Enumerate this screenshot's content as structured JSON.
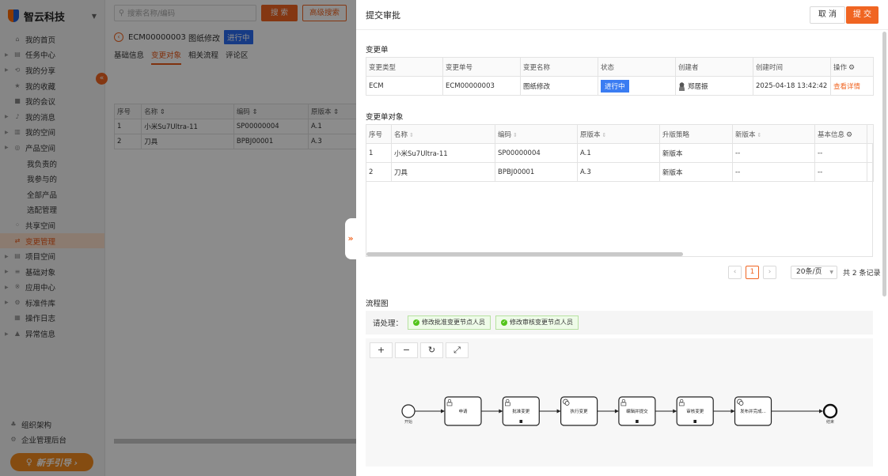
{
  "app": {
    "brand": "智云科技",
    "nav": [
      {
        "label": "我的首页",
        "icon": "home-icon",
        "glyph": "⌂",
        "expand": false,
        "sub": false
      },
      {
        "label": "任务中心",
        "icon": "task-icon",
        "glyph": "▤",
        "expand": true,
        "sub": false
      },
      {
        "label": "我的分享",
        "icon": "share-icon",
        "glyph": "⟲",
        "expand": true,
        "sub": false
      },
      {
        "label": "我的收藏",
        "icon": "star-icon",
        "glyph": "★",
        "expand": false,
        "sub": false
      },
      {
        "label": "我的会议",
        "icon": "meeting-icon",
        "glyph": "■",
        "expand": false,
        "sub": false
      },
      {
        "label": "我的消息",
        "icon": "bell-icon",
        "glyph": "♪",
        "expand": true,
        "sub": false
      },
      {
        "label": "我的空间",
        "icon": "space-icon",
        "glyph": "▥",
        "expand": true,
        "sub": false
      },
      {
        "label": "产品空间",
        "icon": "product-icon",
        "glyph": "◎",
        "expand": true,
        "sub": false
      },
      {
        "label": "我负责的",
        "icon": "",
        "glyph": "",
        "expand": false,
        "sub": true
      },
      {
        "label": "我参与的",
        "icon": "",
        "glyph": "",
        "expand": false,
        "sub": true
      },
      {
        "label": "全部产品",
        "icon": "",
        "glyph": "",
        "expand": false,
        "sub": true
      },
      {
        "label": "选配管理",
        "icon": "",
        "glyph": "",
        "expand": false,
        "sub": true
      },
      {
        "label": "共享空间",
        "icon": "shared-icon",
        "glyph": "⁘",
        "expand": false,
        "sub": false
      },
      {
        "label": "变更管理",
        "icon": "change-icon",
        "glyph": "⇄",
        "expand": false,
        "sub": false,
        "active": true
      },
      {
        "label": "项目空间",
        "icon": "project-icon",
        "glyph": "▤",
        "expand": true,
        "sub": false
      },
      {
        "label": "基础对象",
        "icon": "object-icon",
        "glyph": "≡",
        "expand": true,
        "sub": false
      },
      {
        "label": "应用中心",
        "icon": "app-icon",
        "glyph": "※",
        "expand": true,
        "sub": false
      },
      {
        "label": "标准件库",
        "icon": "library-icon",
        "glyph": "⚙",
        "expand": true,
        "sub": false
      },
      {
        "label": "操作日志",
        "icon": "log-icon",
        "glyph": "▦",
        "expand": false,
        "sub": false
      },
      {
        "label": "异常信息",
        "icon": "warning-icon",
        "glyph": "▲",
        "expand": true,
        "sub": false
      }
    ],
    "bottom_nav": [
      {
        "label": "组织架构",
        "icon": "org-icon",
        "glyph": "♣"
      },
      {
        "label": "企业管理后台",
        "icon": "admin-icon",
        "glyph": "⚙"
      }
    ],
    "guide": "新手引导 ›",
    "search_placeholder": "搜索名称/编码",
    "search_btn": "搜 索",
    "adv_search_btn": "高级搜索",
    "crumb_code": "ECM00000003",
    "crumb_name": "图纸修改",
    "crumb_status": "进行中",
    "tabs": [
      {
        "label": "基础信息",
        "active": false
      },
      {
        "label": "变更对象",
        "active": true
      },
      {
        "label": "相关流程",
        "active": false
      },
      {
        "label": "评论区",
        "active": false
      }
    ],
    "bg_table": {
      "headers": [
        "序号",
        "名称 ⇕",
        "编码 ⇕",
        "原版本 ⇕"
      ],
      "rows": [
        [
          "1",
          "小米Su7Ultra-11",
          "SP00000004",
          "A.1"
        ],
        [
          "2",
          "刀具",
          "BPBJ00001",
          "A.3"
        ]
      ]
    }
  },
  "drawer": {
    "title": "提交审批",
    "cancel": "取 消",
    "submit": "提 交",
    "change_section": "变更单",
    "change_headers": [
      "变更类型",
      "变更单号",
      "变更名称",
      "状态",
      "创建者",
      "创建时间",
      "操作"
    ],
    "change_row": {
      "type": "ECM",
      "code": "ECM00000003",
      "name": "图纸修改",
      "status": "进行中",
      "creator": "郑居振",
      "created": "2025-04-18 13:42:42",
      "action": "查看详情"
    },
    "objects_section": "变更单对象",
    "object_headers": [
      "序号",
      "名称",
      "编码",
      "原版本",
      "升版策略",
      "新版本",
      "基本信息"
    ],
    "object_rows": [
      [
        "1",
        "小米Su7Ultra-11",
        "SP00000004",
        "A.1",
        "新版本",
        "--",
        "--"
      ],
      [
        "2",
        "刀具",
        "BPBJ00001",
        "A.3",
        "新版本",
        "--",
        "--"
      ]
    ],
    "pager": {
      "prev": "‹",
      "page": "1",
      "next": "›",
      "size": "20条/页",
      "total": "共 2 条记录"
    },
    "flow_section": "流程图",
    "pending_label": "请处理：",
    "pending_tags": [
      "修改批准变更节点人员",
      "修改审核变更节点人员"
    ],
    "tools": [
      {
        "glyph": "+",
        "name": "zoom-in-button"
      },
      {
        "glyph": "−",
        "name": "zoom-out-button"
      },
      {
        "glyph": "↻",
        "name": "reset-button"
      },
      {
        "glyph": "⤢",
        "name": "fit-button"
      }
    ],
    "flow": {
      "start": "开始",
      "end": "结束",
      "nodes": [
        {
          "label": "申请",
          "icon": "user-task-icon",
          "has_multi": false
        },
        {
          "label": "批准变更",
          "icon": "user-task-icon",
          "has_multi": true
        },
        {
          "label": "执行变更",
          "icon": "service-task-icon",
          "has_multi": false
        },
        {
          "label": "编辑并提交",
          "icon": "user-task-icon",
          "has_multi": true
        },
        {
          "label": "审核变更",
          "icon": "user-task-icon",
          "has_multi": true
        },
        {
          "label": "发布并完成...",
          "icon": "service-task-icon",
          "has_multi": false
        }
      ]
    }
  }
}
